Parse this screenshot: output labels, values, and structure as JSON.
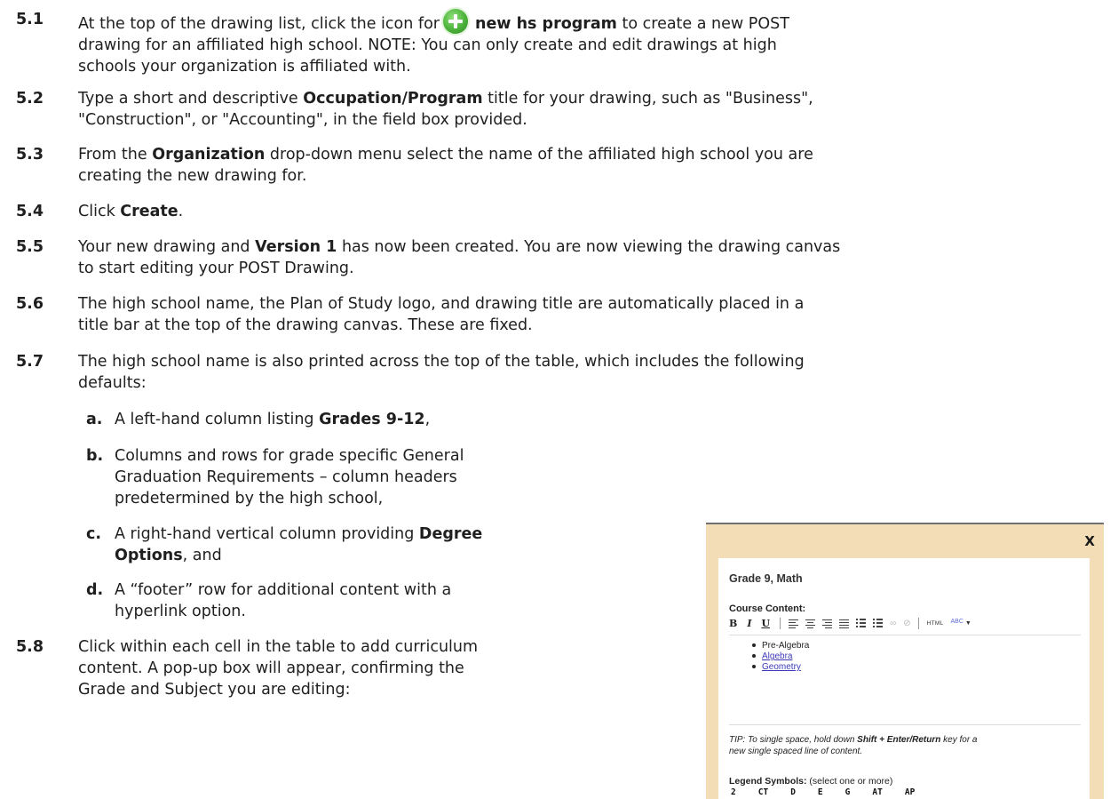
{
  "steps": [
    {
      "num": "5.1",
      "pre": "At the top of the drawing list, click the icon for",
      "bold": "new hs program",
      "post": "to create a new POST",
      "lines": [
        "drawing for an affiliated high school. NOTE: You can only create and edit drawings at high",
        "schools your organization is affiliated with."
      ]
    },
    {
      "num": "5.2",
      "l1a": "Type a short and descriptive ",
      "l1b": "Occupation/Program",
      "l1c": " title for your drawing, such as \"Business\",",
      "l2": "\"Construction\", or \"Accounting\", in the field box provided."
    },
    {
      "num": "5.3",
      "l1a": "From the ",
      "l1b": "Organization",
      "l1c": " drop-down menu select the name of the affiliated high school you are",
      "l2": "creating the new drawing for."
    },
    {
      "num": "5.4",
      "l1a": "Click ",
      "l1b": "Create",
      "l1c": "."
    },
    {
      "num": "5.5",
      "l1a": "Your new drawing and ",
      "l1b": "Version 1",
      "l1c": " has now been created. You are now viewing the drawing canvas",
      "l2": "to start editing your POST Drawing."
    },
    {
      "num": "5.6",
      "l1": "The high school name, the Plan of Study logo, and drawing title are automatically placed in a",
      "l2": "title bar at the top of the drawing canvas. These are fixed."
    },
    {
      "num": "5.7",
      "l1": "The high school name is also printed across the top of the table, which includes the following",
      "l2": "defaults:"
    },
    {
      "num": "5.8",
      "l1": "Click within each cell in the table to add curriculum",
      "l2": "content.  A pop-up box will appear, confirming the",
      "l3": "Grade and Subject you are editing:"
    }
  ],
  "subitems": [
    {
      "letter": "a.",
      "a": "A left-hand column listing ",
      "b": "Grades 9-12",
      "c": ","
    },
    {
      "letter": "b.",
      "l1": "Columns and rows for grade specific General",
      "l2": "Graduation Requirements – column headers",
      "l3": "predetermined by the high school,"
    },
    {
      "letter": "c.",
      "a": "A right-hand vertical column providing ",
      "b": "Degree",
      "l2": "Options",
      "c": ", and"
    },
    {
      "letter": "d.",
      "l1": "A “footer” row for additional content with a",
      "l2": "hyperlink option."
    }
  ],
  "popup": {
    "close": "X",
    "title": "Grade 9, Math",
    "course_content_label": "Course Content:",
    "toolbar": {
      "bold": "B",
      "italic": "I",
      "underline": "U",
      "html": "HTML",
      "spell": "ABC"
    },
    "items": [
      "Pre-Algebra",
      "Algebra",
      "Geometry"
    ],
    "tip": {
      "pre": "TIP: To single space, hold down ",
      "keys": "Shift + Enter/Return",
      "post": " key for a",
      "line2": "new single spaced line of content."
    },
    "legend_label": "Legend Symbols:",
    "legend_hint": " (select one or more)",
    "legend_symbols": [
      "2",
      "CT",
      "D",
      "E",
      "G",
      "AT",
      "AP"
    ]
  }
}
